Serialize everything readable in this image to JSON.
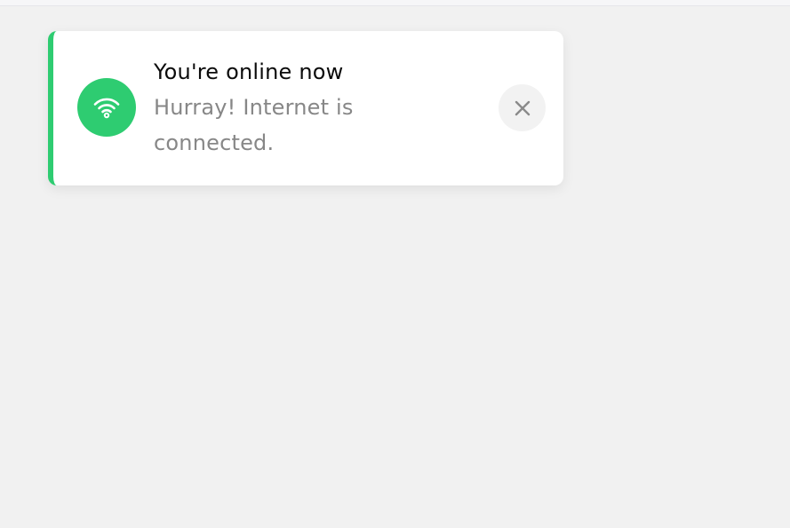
{
  "toast": {
    "title": "You're online now",
    "message": "Hurray! Internet is connected.",
    "accent_color": "#2ecc71",
    "status_icon": "wifi-icon",
    "close_icon": "close-icon"
  }
}
